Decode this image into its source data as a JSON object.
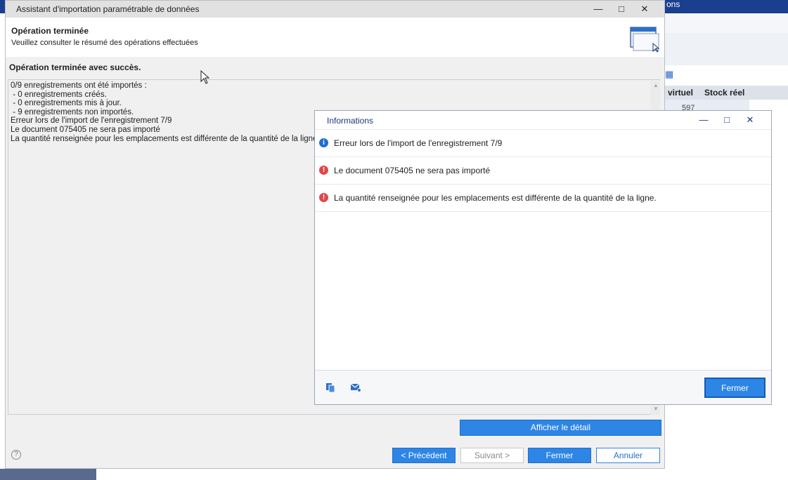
{
  "background": {
    "topbar_text": "ons",
    "col_virtuel": "virtuel",
    "col_stock_reel": "Stock réel",
    "cell_value": "597"
  },
  "wizard": {
    "title": "Assistant d'importation paramétrable de données",
    "step_title": "Opération terminée",
    "step_subtitle": "Veuillez consulter le résumé des opérations effectuées",
    "result_title": "Opération terminée avec succès.",
    "result_lines": [
      "0/9 enregistrements ont été importés :",
      " - 0 enregistrements créés.",
      " - 0 enregistrements mis à jour.",
      " - 9 enregistrements non importés.",
      "Erreur lors de l'import de l'enregistrement 7/9",
      "Le document 075405 ne sera pas importé",
      "La quantité renseignée pour les emplacements est différente de la quantité de la ligne."
    ],
    "btn_detail": "Afficher le détail",
    "btn_previous": "< Précédent",
    "btn_next": "Suivant >",
    "btn_close": "Fermer",
    "btn_cancel": "Annuler",
    "help": "?"
  },
  "info_dialog": {
    "title": "Informations",
    "messages": [
      {
        "type": "info",
        "text": "Erreur lors de l'import de l'enregistrement 7/9"
      },
      {
        "type": "error",
        "text": "Le document 075405 ne sera pas importé"
      },
      {
        "type": "error",
        "text": "La quantité renseignée pour les emplacements est différente de la quantité de la ligne."
      }
    ],
    "btn_close": "Fermer"
  },
  "colors": {
    "accent": "#2d86e6",
    "info": "#1e6fd1",
    "error": "#e04848",
    "topbar": "#1a3f8f"
  }
}
